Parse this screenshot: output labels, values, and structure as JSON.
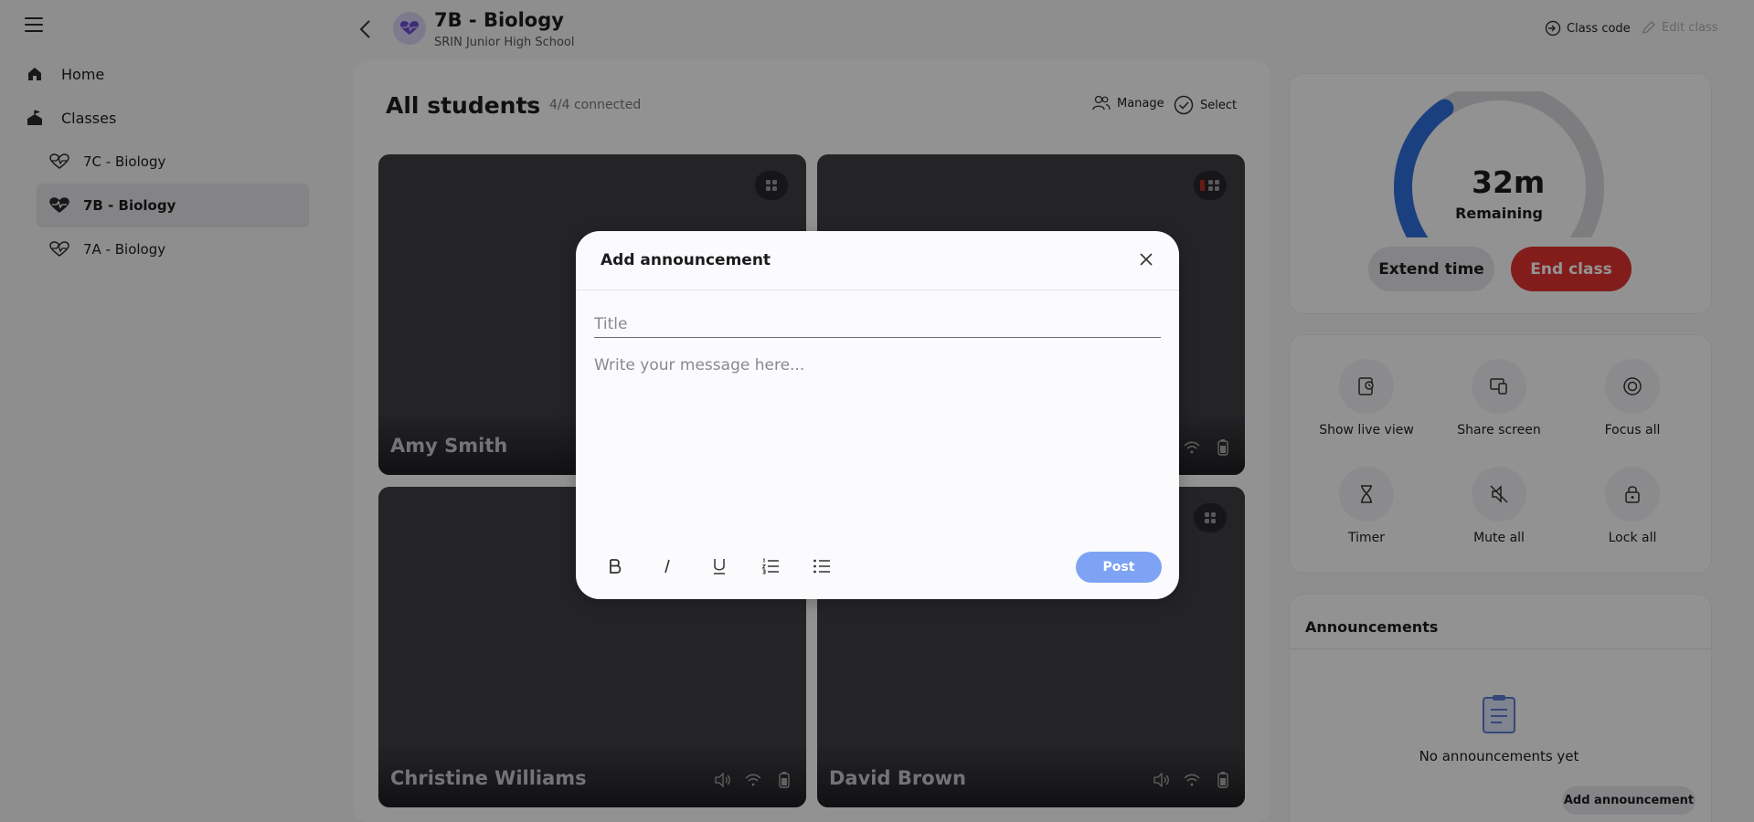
{
  "sidebar": {
    "home_label": "Home",
    "classes_label": "Classes",
    "items": [
      {
        "label": "7C - Biology"
      },
      {
        "label": "7B - Biology"
      },
      {
        "label": "7A - Biology"
      }
    ]
  },
  "header": {
    "class_title": "7B - Biology",
    "school_name": "SRIN Junior High School",
    "class_code_label": "Class code",
    "edit_class_label": "Edit class"
  },
  "main": {
    "students_title": "All students",
    "connected_text": "4/4 connected",
    "manage_label": "Manage",
    "select_label": "Select",
    "students": [
      {
        "name": "Amy Smith"
      },
      {
        "name": ""
      },
      {
        "name": "Christine Williams"
      },
      {
        "name": "David Brown"
      }
    ]
  },
  "timer": {
    "remaining_value": "32m",
    "remaining_label": "Remaining",
    "remaining_fraction": 0.6,
    "extend_label": "Extend time",
    "end_label": "End class"
  },
  "controls": [
    {
      "label": "Show live view",
      "icon": "live-view-icon"
    },
    {
      "label": "Share screen",
      "icon": "share-screen-icon"
    },
    {
      "label": "Focus all",
      "icon": "focus-icon"
    },
    {
      "label": "Timer",
      "icon": "hourglass-icon"
    },
    {
      "label": "Mute all",
      "icon": "mute-icon"
    },
    {
      "label": "Lock all",
      "icon": "lock-icon"
    }
  ],
  "announcements": {
    "title": "Announcements",
    "empty_text": "No announcements yet",
    "add_label": "Add announcement"
  },
  "modal": {
    "title": "Add announcement",
    "title_placeholder": "Title",
    "message_placeholder": "Write your message here...",
    "post_label": "Post"
  },
  "colors": {
    "accent_blue": "#2f6fdc",
    "end_class_red": "#e0322f",
    "post_button": "#7ea3f5"
  }
}
